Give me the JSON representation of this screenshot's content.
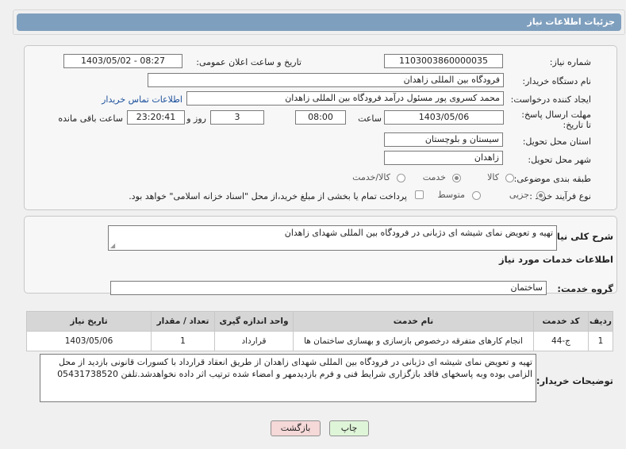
{
  "header": {
    "title": "جزئیات اطلاعات نیاز"
  },
  "form": {
    "need_number": {
      "label": "شماره نیاز:",
      "value": "1103003860000035"
    },
    "announce": {
      "label": "تاریخ و ساعت اعلان عمومی:",
      "value": "1403/05/02 - 08:27"
    },
    "buyer": {
      "label": "نام دستگاه خریدار:",
      "value": "فرودگاه بین المللی زاهدان"
    },
    "creator": {
      "label": "ایجاد کننده درخواست:",
      "value": "محمد کسروی پور مسئول درآمد فرودگاه بین المللی زاهدان",
      "contact_link": "اطلاعات تماس خریدار"
    },
    "deadline": {
      "label": "مهلت ارسال پاسخ: تا تاریخ:",
      "date": "1403/05/06",
      "time_label": "ساعت",
      "time": "08:00",
      "days": "3",
      "days_label": "روز و",
      "remaining": "23:20:41",
      "remaining_label": "ساعت باقی مانده"
    },
    "province": {
      "label": "استان محل تحویل:",
      "value": "سیستان و بلوچستان"
    },
    "city": {
      "label": "شهر محل تحویل:",
      "value": "زاهدان"
    },
    "category": {
      "label": "طبقه بندی موضوعی:",
      "options": [
        "کالا",
        "خدمت",
        "کالا/خدمت"
      ],
      "selected": "خدمت"
    },
    "process": {
      "label": "نوع فرآیند خرید :",
      "options": [
        "جزیی",
        "متوسط"
      ],
      "selected": "جزیی",
      "note": "پرداخت تمام یا بخشی از مبلغ خرید،از محل \"اسناد خزانه اسلامی\" خواهد بود."
    }
  },
  "summary": {
    "label": "شرح کلی نیاز:",
    "value": "تهیه و تعویض نمای شیشه ای دژبانی  در فرودگاه بین المللی  شهدای زاهدان"
  },
  "services": {
    "heading": "اطلاعات خدمات مورد نیاز",
    "group_label": "گروه خدمت:",
    "group_value": "ساختمان",
    "columns": [
      "ردیف",
      "کد خدمت",
      "نام خدمت",
      "واحد اندازه گیری",
      "تعداد / مقدار",
      "تاریخ نیاز"
    ],
    "rows": [
      [
        "1",
        "ج-44",
        "انجام کارهای متفرقه درخصوص بازسازی و بهسازی ساختمان ها",
        "قرارداد",
        "1",
        "1403/05/06"
      ]
    ]
  },
  "buyer_notes": {
    "label": "توضیحات خریدار:",
    "value": "تهیه و تعویض نمای شیشه ای دژبانی  در فرودگاه بین المللی  شهدای زاهدان از طریق انعقاد قرارداد با کسورات قانونی بازدید از محل الزامی بوده وبه پاسخهای فاقد بازگزاری شرایط فنی و فرم بازدیدمهر و امضاء شده ترتیب اثر داده نخواهدشد.تلفن 05431738520"
  },
  "buttons": {
    "print": "چاپ",
    "back": "بازگشت"
  },
  "watermark": {
    "text": "AriaTender.net"
  },
  "colors": {
    "header": "#7f9fbe",
    "print_button": "#dff5d8",
    "back_button": "#f5d8d8",
    "link": "#1a4f9c"
  }
}
